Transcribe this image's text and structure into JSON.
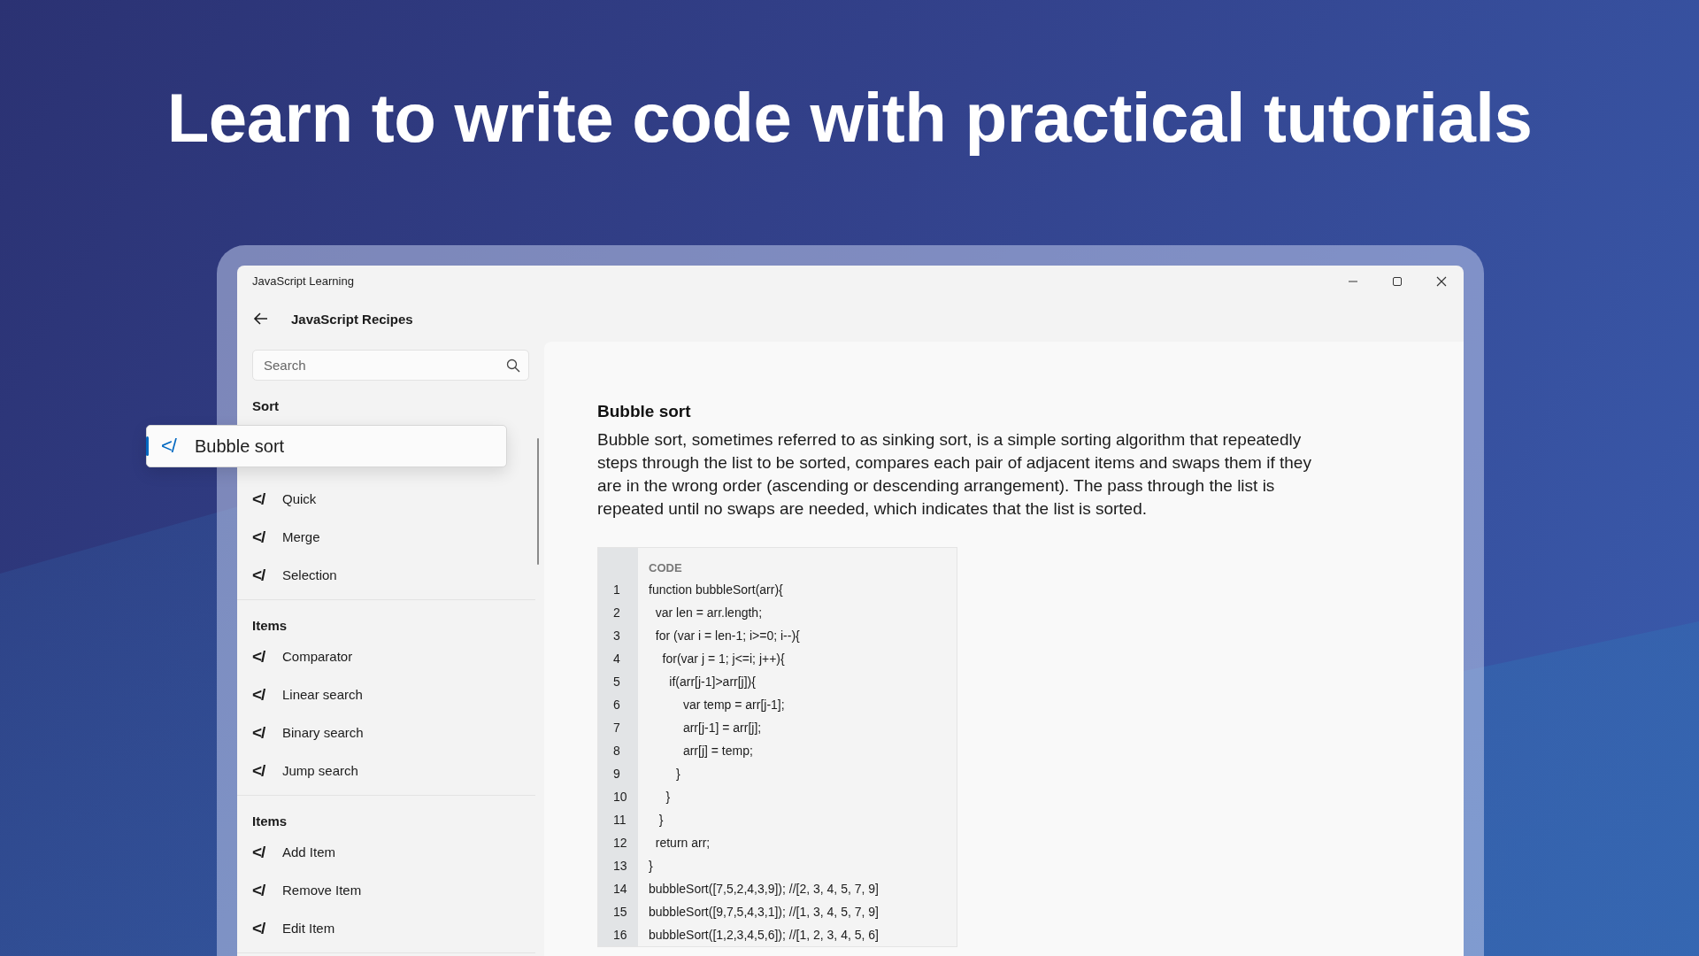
{
  "headline": "Learn to write code with practical tutorials",
  "window": {
    "title": "JavaScript Learning"
  },
  "header": {
    "title": "JavaScript Recipes"
  },
  "search": {
    "placeholder": "Search"
  },
  "groups": [
    {
      "heading": "Sort",
      "items": [
        {
          "icon": "</",
          "label": "Bubble sort",
          "selected": true
        },
        {
          "icon": "</",
          "label": "Quick",
          "selected": false
        },
        {
          "icon": "</",
          "label": "Merge",
          "selected": false
        },
        {
          "icon": "</",
          "label": "Selection",
          "selected": false
        }
      ]
    },
    {
      "heading": "Items",
      "items": [
        {
          "icon": "</",
          "label": "Comparator",
          "selected": false
        },
        {
          "icon": "</",
          "label": "Linear search",
          "selected": false
        },
        {
          "icon": "</",
          "label": "Binary search",
          "selected": false
        },
        {
          "icon": "</",
          "label": "Jump search",
          "selected": false
        }
      ]
    },
    {
      "heading": "Items",
      "items": [
        {
          "icon": "</",
          "label": "Add Item",
          "selected": false
        },
        {
          "icon": "</",
          "label": "Remove Item",
          "selected": false
        },
        {
          "icon": "</",
          "label": "Edit Item",
          "selected": false
        }
      ]
    }
  ],
  "article": {
    "title": "Bubble sort",
    "body": "Bubble sort, sometimes referred to as sinking sort, is a simple sorting algorithm that repeatedly steps through the list to be sorted, compares each pair of adjacent items and swaps them if they are in the wrong order (ascending or descending arrangement). The pass through the list is repeated until no swaps are needed, which indicates that the list is sorted.",
    "code": {
      "heading": "CODE",
      "lines": [
        {
          "number": "1",
          "text": "function bubbleSort(arr){"
        },
        {
          "number": "2",
          "text": "  var len = arr.length;"
        },
        {
          "number": "3",
          "text": "  for (var i = len-1; i>=0; i--){"
        },
        {
          "number": "4",
          "text": "    for(var j = 1; j<=i; j++){"
        },
        {
          "number": "5",
          "text": "      if(arr[j-1]>arr[j]){"
        },
        {
          "number": "6",
          "text": "          var temp = arr[j-1];"
        },
        {
          "number": "7",
          "text": "          arr[j-1] = arr[j];"
        },
        {
          "number": "8",
          "text": "          arr[j] = temp;"
        },
        {
          "number": "9",
          "text": "        }"
        },
        {
          "number": "10",
          "text": "     }"
        },
        {
          "number": "11",
          "text": "   }"
        },
        {
          "number": "12",
          "text": "  return arr;"
        },
        {
          "number": "13",
          "text": "}"
        },
        {
          "number": "14",
          "text": "bubbleSort([7,5,2,4,3,9]); //[2, 3, 4, 5, 7, 9]"
        },
        {
          "number": "15",
          "text": "bubbleSort([9,7,5,4,3,1]); //[1, 3, 4, 5, 7, 9]"
        },
        {
          "number": "16",
          "text": "bubbleSort([1,2,3,4,5,6]); //[1, 2, 3, 4, 5, 6]"
        }
      ]
    }
  }
}
